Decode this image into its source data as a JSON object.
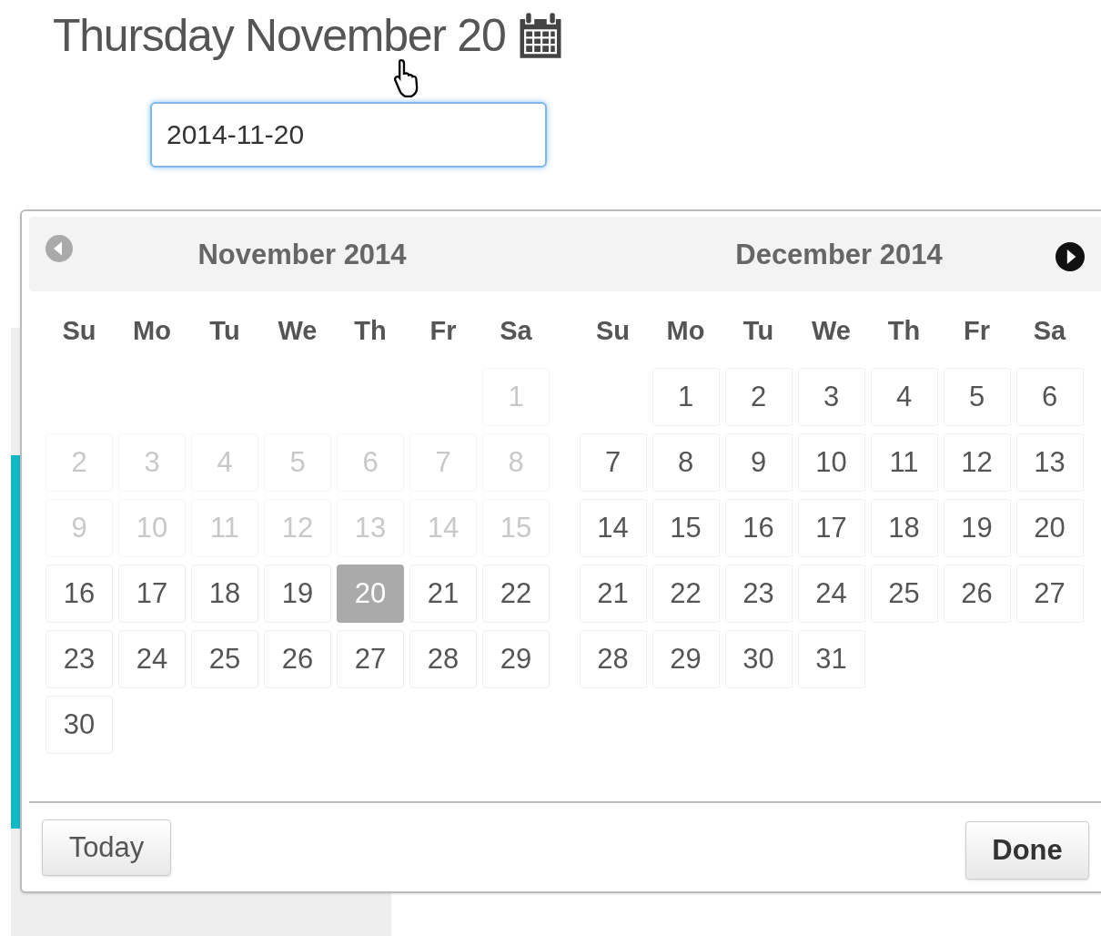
{
  "heading": "Thursday November 20",
  "date_input": {
    "value": "2014-11-20"
  },
  "datepicker": {
    "prev_disabled": true,
    "months": [
      {
        "title": "November 2014",
        "weekdays": [
          "Su",
          "Mo",
          "Tu",
          "We",
          "Th",
          "Fr",
          "Sa"
        ],
        "days": [
          {
            "kind": "blank"
          },
          {
            "kind": "blank"
          },
          {
            "kind": "blank"
          },
          {
            "kind": "blank"
          },
          {
            "kind": "blank"
          },
          {
            "kind": "blank"
          },
          {
            "kind": "day",
            "text": "1",
            "disabled": true,
            "selected": false
          },
          {
            "kind": "day",
            "text": "2",
            "disabled": true,
            "selected": false
          },
          {
            "kind": "day",
            "text": "3",
            "disabled": true,
            "selected": false
          },
          {
            "kind": "day",
            "text": "4",
            "disabled": true,
            "selected": false
          },
          {
            "kind": "day",
            "text": "5",
            "disabled": true,
            "selected": false
          },
          {
            "kind": "day",
            "text": "6",
            "disabled": true,
            "selected": false
          },
          {
            "kind": "day",
            "text": "7",
            "disabled": true,
            "selected": false
          },
          {
            "kind": "day",
            "text": "8",
            "disabled": true,
            "selected": false
          },
          {
            "kind": "day",
            "text": "9",
            "disabled": true,
            "selected": false
          },
          {
            "kind": "day",
            "text": "10",
            "disabled": true,
            "selected": false
          },
          {
            "kind": "day",
            "text": "11",
            "disabled": true,
            "selected": false
          },
          {
            "kind": "day",
            "text": "12",
            "disabled": true,
            "selected": false
          },
          {
            "kind": "day",
            "text": "13",
            "disabled": true,
            "selected": false
          },
          {
            "kind": "day",
            "text": "14",
            "disabled": true,
            "selected": false
          },
          {
            "kind": "day",
            "text": "15",
            "disabled": true,
            "selected": false
          },
          {
            "kind": "day",
            "text": "16",
            "disabled": false,
            "selected": false
          },
          {
            "kind": "day",
            "text": "17",
            "disabled": false,
            "selected": false
          },
          {
            "kind": "day",
            "text": "18",
            "disabled": false,
            "selected": false
          },
          {
            "kind": "day",
            "text": "19",
            "disabled": false,
            "selected": false
          },
          {
            "kind": "day",
            "text": "20",
            "disabled": false,
            "selected": true
          },
          {
            "kind": "day",
            "text": "21",
            "disabled": false,
            "selected": false
          },
          {
            "kind": "day",
            "text": "22",
            "disabled": false,
            "selected": false
          },
          {
            "kind": "day",
            "text": "23",
            "disabled": false,
            "selected": false
          },
          {
            "kind": "day",
            "text": "24",
            "disabled": false,
            "selected": false
          },
          {
            "kind": "day",
            "text": "25",
            "disabled": false,
            "selected": false
          },
          {
            "kind": "day",
            "text": "26",
            "disabled": false,
            "selected": false
          },
          {
            "kind": "day",
            "text": "27",
            "disabled": false,
            "selected": false
          },
          {
            "kind": "day",
            "text": "28",
            "disabled": false,
            "selected": false
          },
          {
            "kind": "day",
            "text": "29",
            "disabled": false,
            "selected": false
          },
          {
            "kind": "day",
            "text": "30",
            "disabled": false,
            "selected": false
          }
        ]
      },
      {
        "title": "December 2014",
        "weekdays": [
          "Su",
          "Mo",
          "Tu",
          "We",
          "Th",
          "Fr",
          "Sa"
        ],
        "days": [
          {
            "kind": "blank"
          },
          {
            "kind": "day",
            "text": "1",
            "disabled": false,
            "selected": false
          },
          {
            "kind": "day",
            "text": "2",
            "disabled": false,
            "selected": false
          },
          {
            "kind": "day",
            "text": "3",
            "disabled": false,
            "selected": false
          },
          {
            "kind": "day",
            "text": "4",
            "disabled": false,
            "selected": false
          },
          {
            "kind": "day",
            "text": "5",
            "disabled": false,
            "selected": false
          },
          {
            "kind": "day",
            "text": "6",
            "disabled": false,
            "selected": false
          },
          {
            "kind": "day",
            "text": "7",
            "disabled": false,
            "selected": false
          },
          {
            "kind": "day",
            "text": "8",
            "disabled": false,
            "selected": false
          },
          {
            "kind": "day",
            "text": "9",
            "disabled": false,
            "selected": false
          },
          {
            "kind": "day",
            "text": "10",
            "disabled": false,
            "selected": false
          },
          {
            "kind": "day",
            "text": "11",
            "disabled": false,
            "selected": false
          },
          {
            "kind": "day",
            "text": "12",
            "disabled": false,
            "selected": false
          },
          {
            "kind": "day",
            "text": "13",
            "disabled": false,
            "selected": false
          },
          {
            "kind": "day",
            "text": "14",
            "disabled": false,
            "selected": false
          },
          {
            "kind": "day",
            "text": "15",
            "disabled": false,
            "selected": false
          },
          {
            "kind": "day",
            "text": "16",
            "disabled": false,
            "selected": false
          },
          {
            "kind": "day",
            "text": "17",
            "disabled": false,
            "selected": false
          },
          {
            "kind": "day",
            "text": "18",
            "disabled": false,
            "selected": false
          },
          {
            "kind": "day",
            "text": "19",
            "disabled": false,
            "selected": false
          },
          {
            "kind": "day",
            "text": "20",
            "disabled": false,
            "selected": false
          },
          {
            "kind": "day",
            "text": "21",
            "disabled": false,
            "selected": false
          },
          {
            "kind": "day",
            "text": "22",
            "disabled": false,
            "selected": false
          },
          {
            "kind": "day",
            "text": "23",
            "disabled": false,
            "selected": false
          },
          {
            "kind": "day",
            "text": "24",
            "disabled": false,
            "selected": false
          },
          {
            "kind": "day",
            "text": "25",
            "disabled": false,
            "selected": false
          },
          {
            "kind": "day",
            "text": "26",
            "disabled": false,
            "selected": false
          },
          {
            "kind": "day",
            "text": "27",
            "disabled": false,
            "selected": false
          },
          {
            "kind": "day",
            "text": "28",
            "disabled": false,
            "selected": false
          },
          {
            "kind": "day",
            "text": "29",
            "disabled": false,
            "selected": false
          },
          {
            "kind": "day",
            "text": "30",
            "disabled": false,
            "selected": false
          },
          {
            "kind": "day",
            "text": "31",
            "disabled": false,
            "selected": false
          }
        ]
      }
    ],
    "buttons": {
      "today": "Today",
      "done": "Done"
    }
  }
}
